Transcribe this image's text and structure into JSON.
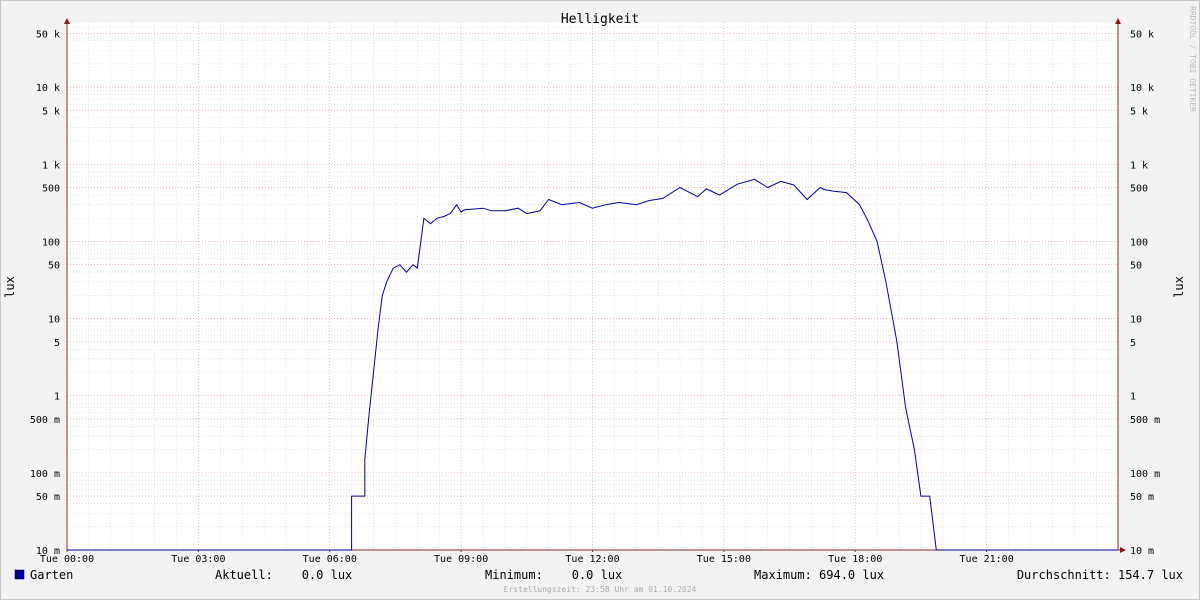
{
  "chart_data": {
    "type": "line",
    "title": "Helligkeit",
    "ylabel": "lux",
    "yscale": "log",
    "ylim": [
      0.01,
      70000
    ],
    "xlim": [
      0,
      24
    ],
    "grid": true,
    "x_ticks": [
      {
        "value": 0,
        "label": "Tue 00:00"
      },
      {
        "value": 3,
        "label": "Tue 03:00"
      },
      {
        "value": 6,
        "label": "Tue 06:00"
      },
      {
        "value": 9,
        "label": "Tue 09:00"
      },
      {
        "value": 12,
        "label": "Tue 12:00"
      },
      {
        "value": 15,
        "label": "Tue 15:00"
      },
      {
        "value": 18,
        "label": "Tue 18:00"
      },
      {
        "value": 21,
        "label": "Tue 21:00"
      }
    ],
    "y_ticks": [
      {
        "value": 50000,
        "label": "50 k"
      },
      {
        "value": 10000,
        "label": "10 k"
      },
      {
        "value": 5000,
        "label": "5 k"
      },
      {
        "value": 1000,
        "label": "1 k"
      },
      {
        "value": 500,
        "label": "500"
      },
      {
        "value": 100,
        "label": "100"
      },
      {
        "value": 50,
        "label": "50"
      },
      {
        "value": 10,
        "label": "10"
      },
      {
        "value": 5,
        "label": "5"
      },
      {
        "value": 1,
        "label": "1"
      },
      {
        "value": 0.5,
        "label": "500 m"
      },
      {
        "value": 0.1,
        "label": "100 m"
      },
      {
        "value": 0.05,
        "label": "50 m"
      },
      {
        "value": 0.01,
        "label": "10 m"
      }
    ],
    "series": [
      {
        "name": "Garten",
        "color": "#0000a0",
        "x": [
          0,
          6.5,
          6.5,
          6.8,
          6.8,
          6.9,
          7.0,
          7.1,
          7.2,
          7.3,
          7.45,
          7.6,
          7.75,
          7.9,
          8.0,
          8.15,
          8.3,
          8.45,
          8.6,
          8.75,
          8.9,
          9.0,
          9.1,
          9.2,
          9.5,
          9.7,
          10.0,
          10.3,
          10.5,
          10.8,
          11.0,
          11.3,
          11.7,
          12.0,
          12.3,
          12.6,
          13.0,
          13.3,
          13.6,
          14.0,
          14.4,
          14.6,
          14.9,
          15.3,
          15.7,
          16.0,
          16.3,
          16.6,
          16.9,
          17.2,
          17.3,
          17.5,
          17.8,
          18.1,
          18.3,
          18.5,
          18.7,
          18.95,
          19.15,
          19.35,
          19.5,
          19.7,
          19.85,
          19.95,
          19.95,
          20.1,
          24
        ],
        "y": [
          0.01,
          0.01,
          0.05,
          0.05,
          0.15,
          0.6,
          2,
          7,
          20,
          30,
          45,
          50,
          40,
          50,
          45,
          200,
          170,
          200,
          210,
          230,
          300,
          240,
          260,
          260,
          270,
          250,
          250,
          270,
          230,
          250,
          350,
          300,
          320,
          270,
          300,
          320,
          300,
          340,
          360,
          500,
          380,
          480,
          400,
          550,
          640,
          500,
          600,
          540,
          350,
          500,
          470,
          450,
          430,
          300,
          180,
          100,
          30,
          5,
          0.7,
          0.2,
          0.05,
          0.05,
          0.01,
          0.01,
          0.01,
          0.01,
          0.01
        ]
      }
    ]
  },
  "legend": {
    "series_name": "Garten",
    "swatch_color": "#0000a0",
    "current": "Aktuell:    0.0 lux",
    "minimum": "Minimum:    0.0 lux",
    "maximum": "Maximum: 694.0 lux",
    "average": "Durchschnitt: 154.7 lux"
  },
  "footer": "Erstellungszeit: 23:58 Uhr am 01.10.2024",
  "watermark": "RRDTOOL / TOBI OETIKER"
}
